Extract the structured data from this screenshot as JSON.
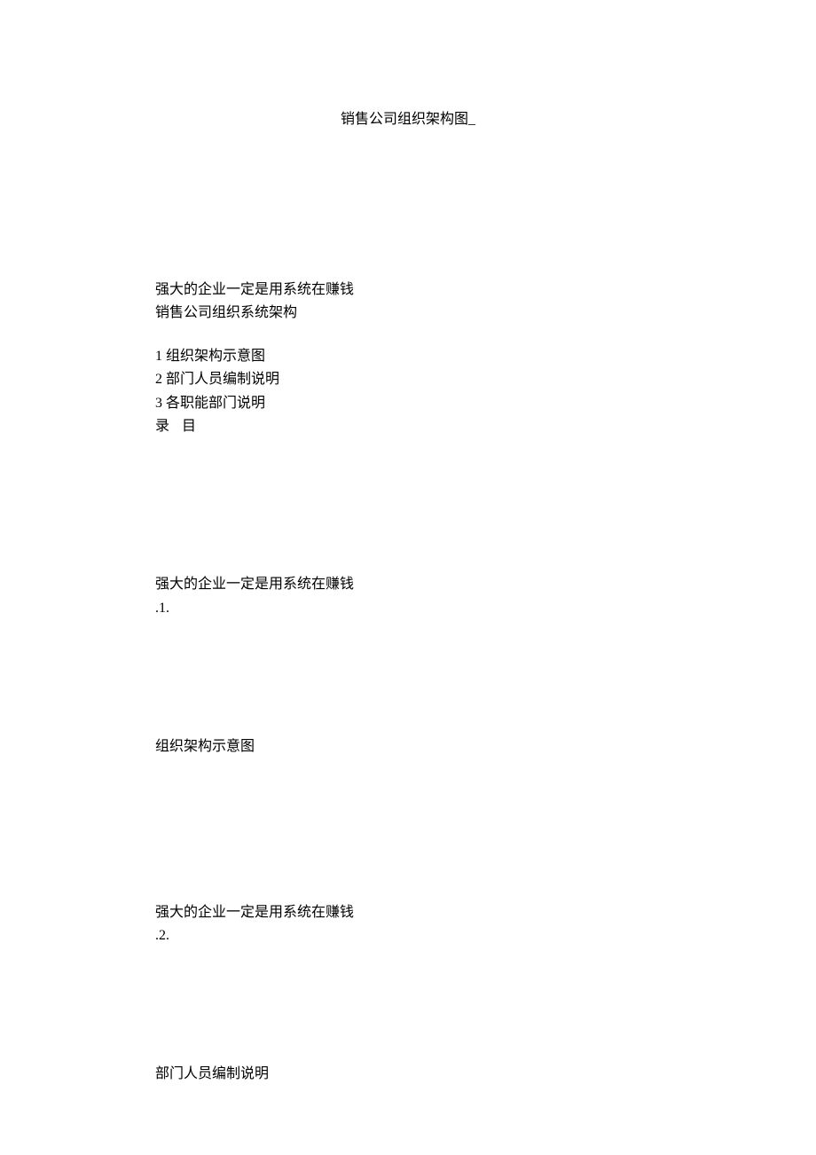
{
  "title": {
    "text": "销售公司组织架构图",
    "cursor": "_"
  },
  "intro": {
    "line1": "强大的企业一定是用系统在赚钱",
    "line2": "销售公司组织系统架构"
  },
  "toc": {
    "item1": "1 组织架构示意图",
    "item2": "2 部门人员编制说明",
    "item3": "3 各职能部门说明",
    "label_lu": "录",
    "label_mu": "目"
  },
  "section1": {
    "header": "强大的企业一定是用系统在赚钱",
    "number": ".1.",
    "title": "组织架构示意图"
  },
  "section2": {
    "header": "强大的企业一定是用系统在赚钱",
    "number": ".2.",
    "title": "部门人员编制说明"
  }
}
